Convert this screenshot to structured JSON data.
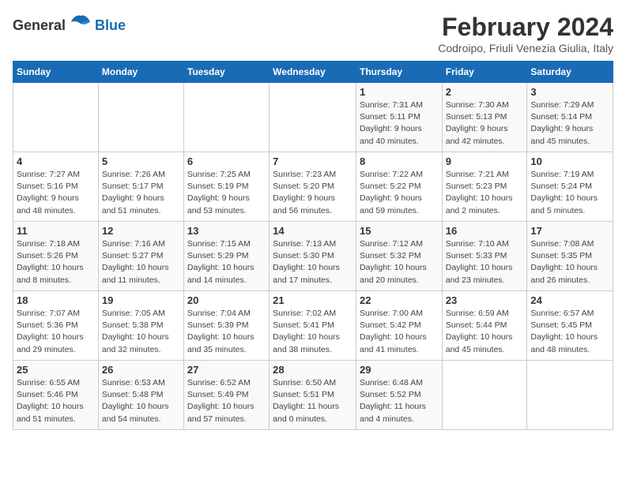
{
  "header": {
    "logo_general": "General",
    "logo_blue": "Blue",
    "title": "February 2024",
    "subtitle": "Codroipo, Friuli Venezia Giulia, Italy"
  },
  "weekdays": [
    "Sunday",
    "Monday",
    "Tuesday",
    "Wednesday",
    "Thursday",
    "Friday",
    "Saturday"
  ],
  "weeks": [
    [
      {
        "day": "",
        "info": ""
      },
      {
        "day": "",
        "info": ""
      },
      {
        "day": "",
        "info": ""
      },
      {
        "day": "",
        "info": ""
      },
      {
        "day": "1",
        "info": "Sunrise: 7:31 AM\nSunset: 5:11 PM\nDaylight: 9 hours\nand 40 minutes."
      },
      {
        "day": "2",
        "info": "Sunrise: 7:30 AM\nSunset: 5:13 PM\nDaylight: 9 hours\nand 42 minutes."
      },
      {
        "day": "3",
        "info": "Sunrise: 7:29 AM\nSunset: 5:14 PM\nDaylight: 9 hours\nand 45 minutes."
      }
    ],
    [
      {
        "day": "4",
        "info": "Sunrise: 7:27 AM\nSunset: 5:16 PM\nDaylight: 9 hours\nand 48 minutes."
      },
      {
        "day": "5",
        "info": "Sunrise: 7:26 AM\nSunset: 5:17 PM\nDaylight: 9 hours\nand 51 minutes."
      },
      {
        "day": "6",
        "info": "Sunrise: 7:25 AM\nSunset: 5:19 PM\nDaylight: 9 hours\nand 53 minutes."
      },
      {
        "day": "7",
        "info": "Sunrise: 7:23 AM\nSunset: 5:20 PM\nDaylight: 9 hours\nand 56 minutes."
      },
      {
        "day": "8",
        "info": "Sunrise: 7:22 AM\nSunset: 5:22 PM\nDaylight: 9 hours\nand 59 minutes."
      },
      {
        "day": "9",
        "info": "Sunrise: 7:21 AM\nSunset: 5:23 PM\nDaylight: 10 hours\nand 2 minutes."
      },
      {
        "day": "10",
        "info": "Sunrise: 7:19 AM\nSunset: 5:24 PM\nDaylight: 10 hours\nand 5 minutes."
      }
    ],
    [
      {
        "day": "11",
        "info": "Sunrise: 7:18 AM\nSunset: 5:26 PM\nDaylight: 10 hours\nand 8 minutes."
      },
      {
        "day": "12",
        "info": "Sunrise: 7:16 AM\nSunset: 5:27 PM\nDaylight: 10 hours\nand 11 minutes."
      },
      {
        "day": "13",
        "info": "Sunrise: 7:15 AM\nSunset: 5:29 PM\nDaylight: 10 hours\nand 14 minutes."
      },
      {
        "day": "14",
        "info": "Sunrise: 7:13 AM\nSunset: 5:30 PM\nDaylight: 10 hours\nand 17 minutes."
      },
      {
        "day": "15",
        "info": "Sunrise: 7:12 AM\nSunset: 5:32 PM\nDaylight: 10 hours\nand 20 minutes."
      },
      {
        "day": "16",
        "info": "Sunrise: 7:10 AM\nSunset: 5:33 PM\nDaylight: 10 hours\nand 23 minutes."
      },
      {
        "day": "17",
        "info": "Sunrise: 7:08 AM\nSunset: 5:35 PM\nDaylight: 10 hours\nand 26 minutes."
      }
    ],
    [
      {
        "day": "18",
        "info": "Sunrise: 7:07 AM\nSunset: 5:36 PM\nDaylight: 10 hours\nand 29 minutes."
      },
      {
        "day": "19",
        "info": "Sunrise: 7:05 AM\nSunset: 5:38 PM\nDaylight: 10 hours\nand 32 minutes."
      },
      {
        "day": "20",
        "info": "Sunrise: 7:04 AM\nSunset: 5:39 PM\nDaylight: 10 hours\nand 35 minutes."
      },
      {
        "day": "21",
        "info": "Sunrise: 7:02 AM\nSunset: 5:41 PM\nDaylight: 10 hours\nand 38 minutes."
      },
      {
        "day": "22",
        "info": "Sunrise: 7:00 AM\nSunset: 5:42 PM\nDaylight: 10 hours\nand 41 minutes."
      },
      {
        "day": "23",
        "info": "Sunrise: 6:59 AM\nSunset: 5:44 PM\nDaylight: 10 hours\nand 45 minutes."
      },
      {
        "day": "24",
        "info": "Sunrise: 6:57 AM\nSunset: 5:45 PM\nDaylight: 10 hours\nand 48 minutes."
      }
    ],
    [
      {
        "day": "25",
        "info": "Sunrise: 6:55 AM\nSunset: 5:46 PM\nDaylight: 10 hours\nand 51 minutes."
      },
      {
        "day": "26",
        "info": "Sunrise: 6:53 AM\nSunset: 5:48 PM\nDaylight: 10 hours\nand 54 minutes."
      },
      {
        "day": "27",
        "info": "Sunrise: 6:52 AM\nSunset: 5:49 PM\nDaylight: 10 hours\nand 57 minutes."
      },
      {
        "day": "28",
        "info": "Sunrise: 6:50 AM\nSunset: 5:51 PM\nDaylight: 11 hours\nand 0 minutes."
      },
      {
        "day": "29",
        "info": "Sunrise: 6:48 AM\nSunset: 5:52 PM\nDaylight: 11 hours\nand 4 minutes."
      },
      {
        "day": "",
        "info": ""
      },
      {
        "day": "",
        "info": ""
      }
    ]
  ]
}
